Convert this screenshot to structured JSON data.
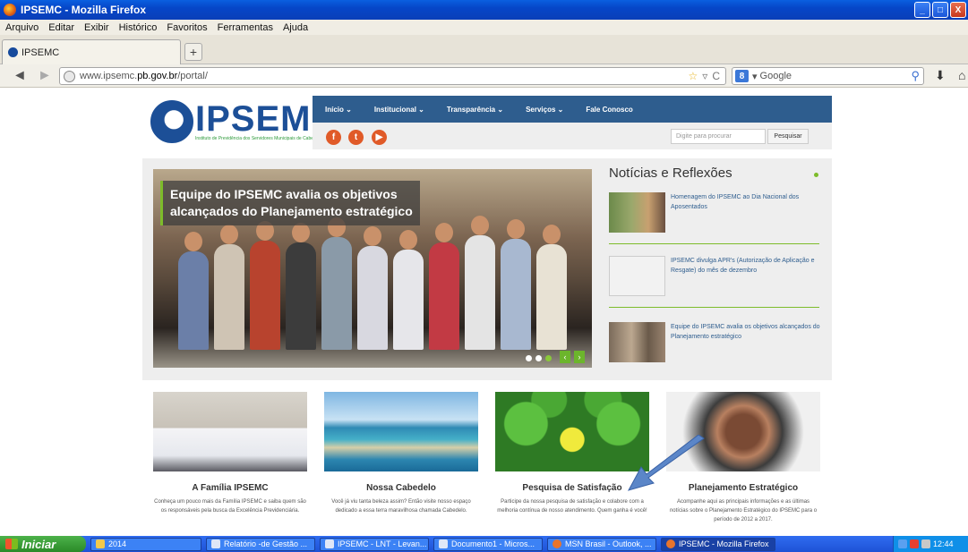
{
  "window": {
    "title": "IPSEMC - Mozilla Firefox",
    "min": "_",
    "max": "□",
    "close": "X"
  },
  "menu": [
    "Arquivo",
    "Editar",
    "Exibir",
    "Histórico",
    "Favoritos",
    "Ferramentas",
    "Ajuda"
  ],
  "tab": {
    "label": "IPSEMC",
    "new_tab": "+"
  },
  "nav": {
    "back": "◄",
    "forward": "►",
    "url_prefix": "www.ipsemc.",
    "url_domain": "pb.gov.br",
    "url_path": "/portal/",
    "search_engine": "Google",
    "search_engine_badge": "8"
  },
  "site": {
    "logo": "IPSEMC",
    "logo_sub": "Instituto de Previdência dos Servidores Municipais de Cabedelo",
    "nav": [
      "Início ⌄",
      "Institucional ⌄",
      "Transparência ⌄",
      "Serviços ⌄",
      "Fale Conosco"
    ],
    "social": [
      {
        "name": "facebook",
        "glyph": "f",
        "color": "#e05a28"
      },
      {
        "name": "twitter",
        "glyph": "t",
        "color": "#e05a28"
      },
      {
        "name": "youtube",
        "glyph": "▶",
        "color": "#e05a28"
      }
    ],
    "search_placeholder": "Digite para procurar",
    "search_button": "Pesquisar",
    "slide_caption": "Equipe do IPSEMC avalia os objetivos alcançados do Planejamento estratégico",
    "slide_prev": "‹",
    "slide_next": "›",
    "news_heading": "Notícias e Reflexões",
    "news": [
      {
        "text": "Homenagem do IPSEMC ao Dia Nacional dos Aposentados"
      },
      {
        "text": "IPSEMC divulga APR's (Autorização de Aplicação e Resgate) do mês de dezembro"
      },
      {
        "text": "Equipe do IPSEMC avalia os objetivos alcançados do Planejamento estratégico"
      }
    ],
    "cards": [
      {
        "title": "A Família IPSEMC",
        "desc": "Conheça um pouco mais da Família IPSEMC e saiba quem são os responsáveis pela busca da Excelência Previdenciária."
      },
      {
        "title": "Nossa Cabedelo",
        "desc": "Você já viu tanta beleza assim? Então visite nosso espaço dedicado a essa terra maravilhosa chamada Cabedelo."
      },
      {
        "title": "Pesquisa de Satisfação",
        "desc": "Participe da nossa pesquisa de satisfação e colabore com a melhoria contínua de nosso atendimento. Quem ganha é você!"
      },
      {
        "title": "Planejamento Estratégico",
        "desc": "Acompanhe aqui as principais informações e as últimas notícias sobre o Planejamento Estratégico do IPSEMC para o período de 2012 a 2017."
      }
    ]
  },
  "taskbar": {
    "start": "Iniciar",
    "tasks": [
      {
        "label": "2014",
        "active": false
      },
      {
        "label": "Relatório -de Gestão ...",
        "active": false
      },
      {
        "label": "IPSEMC - LNT - Levan...",
        "active": false
      },
      {
        "label": "Documento1 - Micros...",
        "active": false
      },
      {
        "label": "MSN Brasil - Outlook, ...",
        "active": false
      },
      {
        "label": "IPSEMC - Mozilla Firefox",
        "active": true
      }
    ],
    "clock": "12:44"
  }
}
